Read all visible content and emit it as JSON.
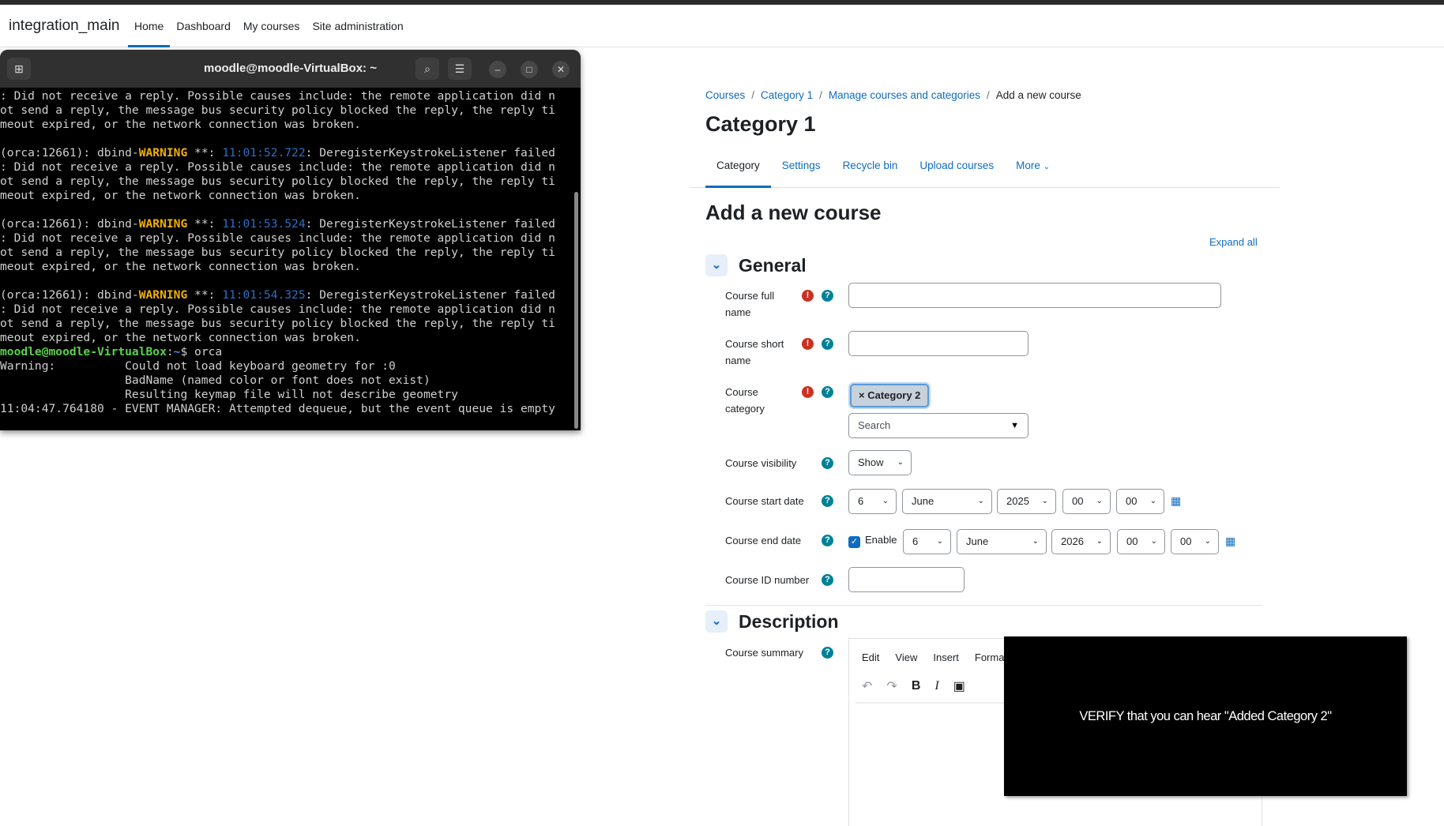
{
  "navbar": {
    "brand": "integration_main",
    "links": [
      "Home",
      "Dashboard",
      "My courses",
      "Site administration"
    ]
  },
  "terminal": {
    "title": "moodle@moodle-VirtualBox: ~",
    "buttons": {
      "new_tab": "⊞",
      "search": "⌕",
      "menu": "☰",
      "minimize": "–",
      "maximize": "□",
      "close": "✕"
    },
    "lines": [
      {
        "a": ": Did not receive a reply. Possible causes include: the remote application did n"
      },
      {
        "a": "ot send a reply, the message bus security policy blocked the reply, the reply ti"
      },
      {
        "a": "meout expired, or the network connection was broken."
      },
      {
        "a": ""
      },
      {
        "a": "(orca:12661): dbind-",
        "w": "WARNING",
        "b": " **: ",
        "t": "11:01:52.722",
        "c": ": DeregisterKeystrokeListener failed"
      },
      {
        "a": ": Did not receive a reply. Possible causes include: the remote application did n"
      },
      {
        "a": "ot send a reply, the message bus security policy blocked the reply, the reply ti"
      },
      {
        "a": "meout expired, or the network connection was broken."
      },
      {
        "a": ""
      },
      {
        "a": "(orca:12661): dbind-",
        "w": "WARNING",
        "b": " **: ",
        "t": "11:01:53.524",
        "c": ": DeregisterKeystrokeListener failed"
      },
      {
        "a": ": Did not receive a reply. Possible causes include: the remote application did n"
      },
      {
        "a": "ot send a reply, the message bus security policy blocked the reply, the reply ti"
      },
      {
        "a": "meout expired, or the network connection was broken."
      },
      {
        "a": ""
      },
      {
        "a": "(orca:12661): dbind-",
        "w": "WARNING",
        "b": " **: ",
        "t": "11:01:54.325",
        "c": ": DeregisterKeystrokeListener failed"
      },
      {
        "a": ": Did not receive a reply. Possible causes include: the remote application did n"
      },
      {
        "a": "ot send a reply, the message bus security policy blocked the reply, the reply ti"
      },
      {
        "a": "meout expired, or the network connection was broken."
      },
      {
        "p": "moodle@moodle-VirtualBox",
        "q": ":",
        "r": "~",
        "s": "$ orca"
      },
      {
        "a": "Warning:          Could not load keyboard geometry for :0"
      },
      {
        "a": "                  BadName (named color or font does not exist)"
      },
      {
        "a": "                  Resulting keymap file will not describe geometry"
      },
      {
        "a": "11:04:47.764180 - EVENT MANAGER: Attempted dequeue, but the event queue is empty"
      }
    ]
  },
  "breadcrumb": [
    "Courses",
    "Category 1",
    "Manage courses and categories",
    "Add a new course"
  ],
  "page_title": "Category 1",
  "tabs": [
    "Category",
    "Settings",
    "Recycle bin",
    "Upload courses",
    "More"
  ],
  "form_title": "Add a new course",
  "expand_all": "Expand all",
  "sections": {
    "general": "General",
    "description": "Description"
  },
  "fields": {
    "full_name": {
      "label": "Course full name",
      "value": ""
    },
    "short_name": {
      "label": "Course short name",
      "value": ""
    },
    "category": {
      "label": "Course category",
      "tag": "× Category 2",
      "search_placeholder": "Search"
    },
    "visibility": {
      "label": "Course visibility",
      "value": "Show"
    },
    "start_date": {
      "label": "Course start date",
      "day": "6",
      "month": "June",
      "year": "2025",
      "hour": "00",
      "minute": "00"
    },
    "end_date": {
      "label": "Course end date",
      "enable": "Enable",
      "day": "6",
      "month": "June",
      "year": "2026",
      "hour": "00",
      "minute": "00"
    },
    "id_number": {
      "label": "Course ID number",
      "value": ""
    },
    "summary": {
      "label": "Course summary"
    }
  },
  "editor": {
    "menus": [
      "Edit",
      "View",
      "Insert",
      "Format"
    ],
    "tools": {
      "undo": "↶",
      "redo": "↷",
      "bold": "B",
      "italic": "I",
      "image": "▣"
    }
  },
  "overlay": {
    "text": "VERIFY that you can hear \"Added Category 2\""
  },
  "icons": {
    "required": "!",
    "help": "?",
    "chevron": "⌄",
    "calendar": "▦",
    "dropdown": "▼",
    "check": "✓"
  }
}
